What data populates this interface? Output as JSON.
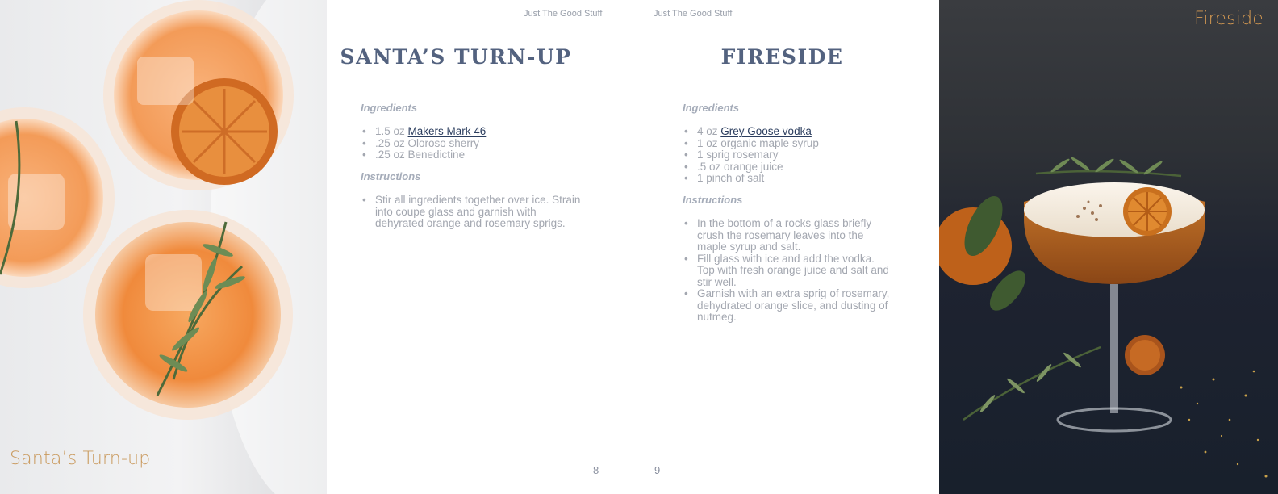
{
  "photos": {
    "left": {
      "caption": "Santa’s Turn-up"
    },
    "right": {
      "caption": "Fireside"
    }
  },
  "pages": {
    "left": {
      "running_head": "Just The Good Stuff",
      "title": "SANTA’S TURN-UP",
      "ingredients_heading": "Ingredients",
      "ingredients": [
        {
          "prefix": "1.5 oz ",
          "link": "Makers Mark 46",
          "text": ""
        },
        {
          "prefix": ".25 oz Oloroso sherry",
          "link": "",
          "text": ""
        },
        {
          "prefix": ".25 oz Benedictine",
          "link": "",
          "text": ""
        }
      ],
      "instructions_heading": "Instructions",
      "instructions": [
        "Stir all ingredients together over ice. Strain into coupe glass and garnish with dehyrated orange and rosemary sprigs."
      ],
      "page_number": "8"
    },
    "right": {
      "running_head": "Just The Good Stuff",
      "title": "FIRESIDE",
      "ingredients_heading": "Ingredients",
      "ingredients": [
        {
          "prefix": "4 oz ",
          "link": "Grey Goose vodka",
          "text": ""
        },
        {
          "prefix": "1 oz organic maple syrup",
          "link": "",
          "text": ""
        },
        {
          "prefix": "1 sprig rosemary",
          "link": "",
          "text": ""
        },
        {
          "prefix": ".5 oz orange juice",
          "link": "",
          "text": ""
        },
        {
          "prefix": "1 pinch of salt",
          "link": "",
          "text": ""
        }
      ],
      "instructions_heading": "Instructions",
      "instructions": [
        "In the bottom of a rocks glass briefly crush the rosemary leaves into the maple syrup and salt.",
        "Fill glass with ice and add the vodka. Top with fresh orange juice and salt and stir well.",
        "Garnish with an extra sprig of rosemary, dehydrated orange slice, and dusting of nutmeg."
      ],
      "page_number": "9"
    }
  }
}
